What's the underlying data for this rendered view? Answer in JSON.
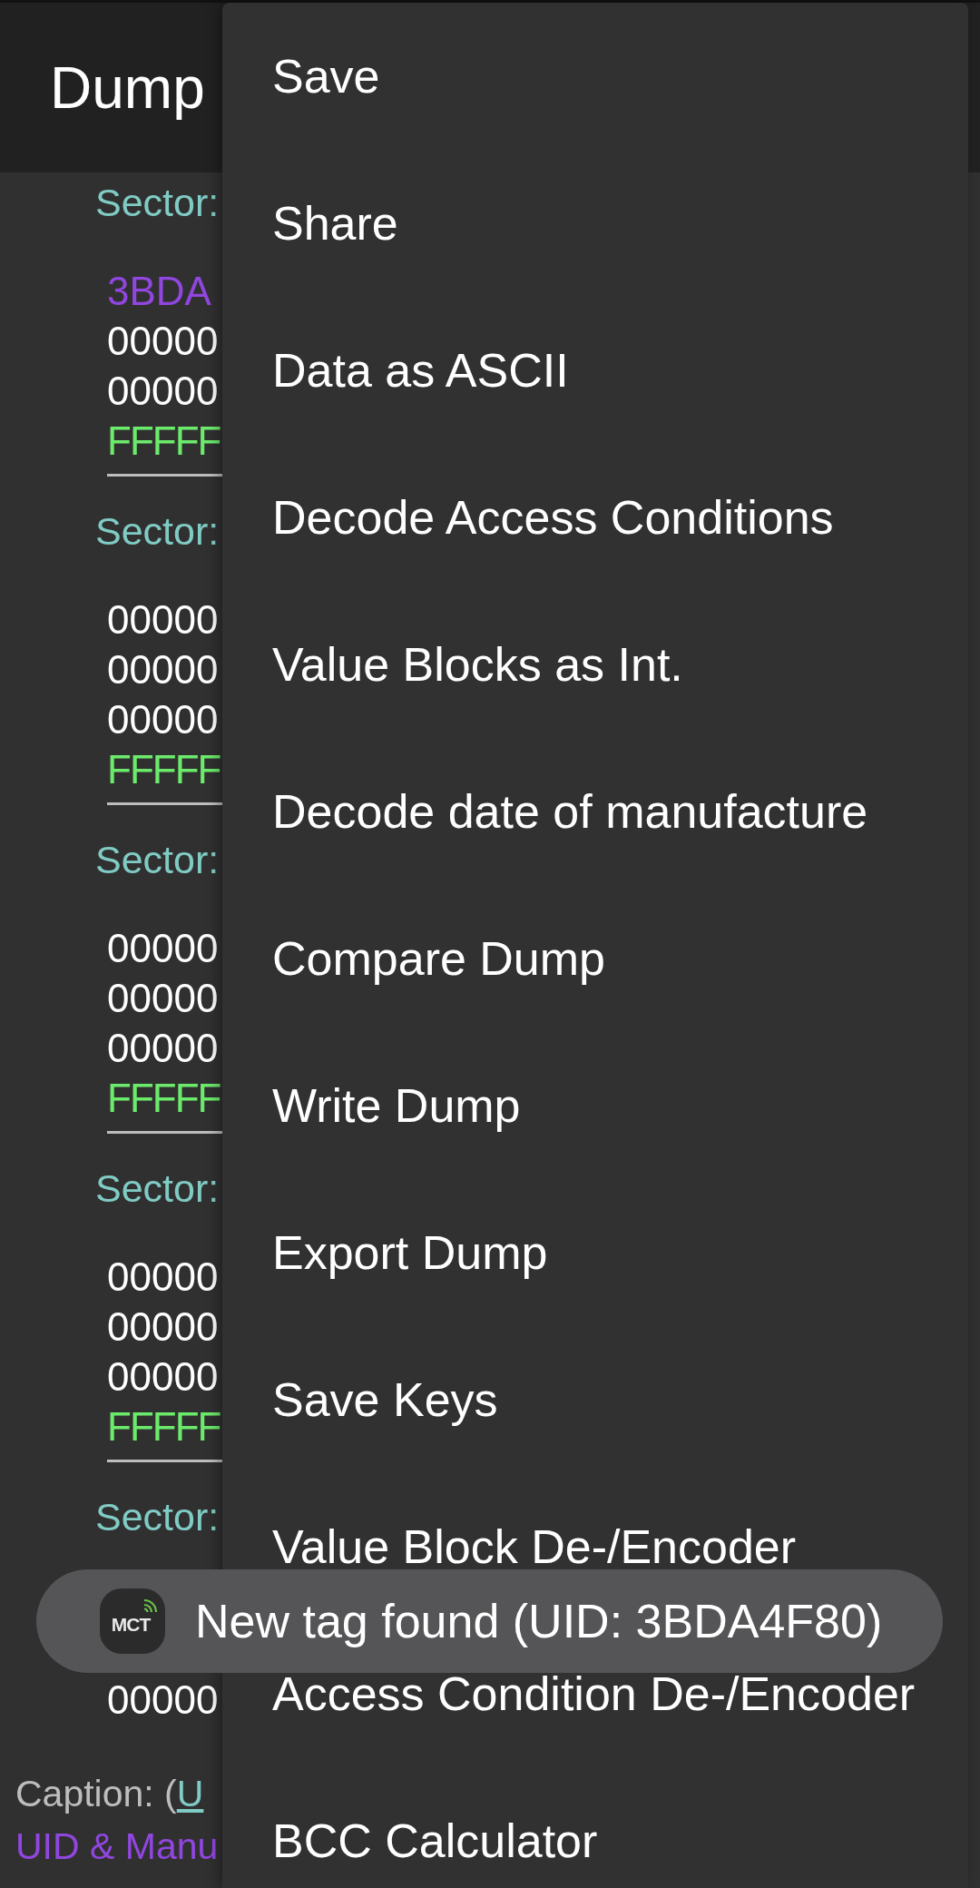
{
  "app_bar": {
    "title": "Dump"
  },
  "sectors": [
    {
      "label": "Sector:",
      "lines": [
        {
          "kind": "uid",
          "text": "3BDA"
        },
        {
          "kind": "data",
          "text": "00000"
        },
        {
          "kind": "data",
          "text": "00000"
        },
        {
          "kind": "trailer",
          "text": "FFFFF"
        }
      ]
    },
    {
      "label": "Sector:",
      "lines": [
        {
          "kind": "data",
          "text": "00000"
        },
        {
          "kind": "data",
          "text": "00000"
        },
        {
          "kind": "data",
          "text": "00000"
        },
        {
          "kind": "trailer",
          "text": "FFFFF"
        }
      ]
    },
    {
      "label": "Sector:",
      "lines": [
        {
          "kind": "data",
          "text": "00000"
        },
        {
          "kind": "data",
          "text": "00000"
        },
        {
          "kind": "data",
          "text": "00000"
        },
        {
          "kind": "trailer",
          "text": "FFFFF"
        }
      ]
    },
    {
      "label": "Sector:",
      "lines": [
        {
          "kind": "data",
          "text": "00000"
        },
        {
          "kind": "data",
          "text": "00000"
        },
        {
          "kind": "data",
          "text": "00000"
        },
        {
          "kind": "trailer",
          "text": "FFFFF"
        }
      ]
    },
    {
      "label": "Sector:",
      "lines": [
        {
          "kind": "data",
          "text": "00000"
        }
      ]
    }
  ],
  "caption": {
    "label": "Caption: (",
    "link": "U"
  },
  "legend": [
    {
      "kind": "uid",
      "text": "UID & Manu"
    }
  ],
  "menu": {
    "items": [
      "Save",
      "Share",
      "Data as ASCII",
      "Decode Access Conditions",
      "Value Blocks as Int.",
      "Decode date of manufacture",
      "Compare Dump",
      "Write Dump",
      "Export Dump",
      "Save Keys",
      "Value Block De-/Encoder",
      "Access Condition De-/Encoder",
      "BCC Calculator"
    ]
  },
  "toast": {
    "logo": "MCT",
    "message": "New tag found (UID: 3BDA4F80)"
  }
}
